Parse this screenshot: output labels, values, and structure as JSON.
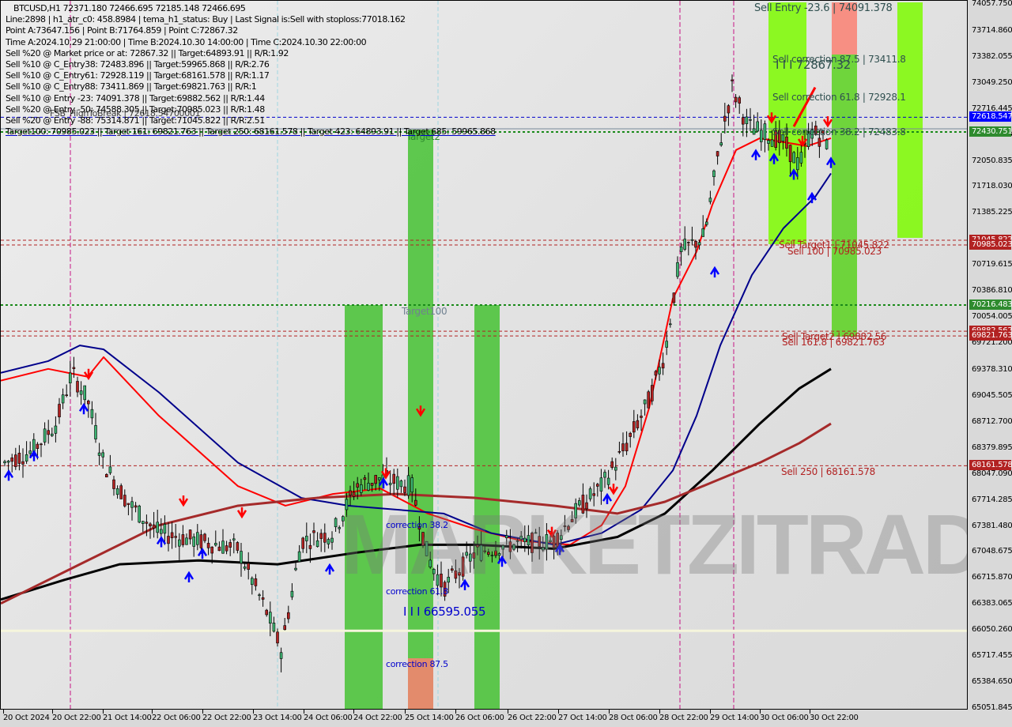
{
  "chart_data": {
    "type": "candlestick",
    "symbol": "BTCUSD",
    "timeframe": "H1",
    "ohlc_header": {
      "open": "72371.180",
      "high": "72466.695",
      "low": "72185.148",
      "close": "72466.695"
    },
    "ylim": [
      65051.845,
      74057.75
    ],
    "y_ticks": [
      "74057.750",
      "73714.860",
      "73382.055",
      "73049.250",
      "72716.445",
      "72383.640",
      "72050.835",
      "71718.030",
      "71385.225",
      "70719.615",
      "70386.810",
      "70054.005",
      "69721.200",
      "69378.310",
      "69045.505",
      "68712.700",
      "68379.895",
      "68047.090",
      "67714.285",
      "67381.480",
      "67048.675",
      "66715.870",
      "66383.065",
      "66050.260",
      "65717.455",
      "65384.650",
      "65051.845"
    ],
    "y_tick_values": [
      74057.75,
      73714.86,
      73382.055,
      73049.25,
      72716.445,
      72383.64,
      72050.835,
      71718.03,
      71385.225,
      70719.615,
      70386.81,
      70054.005,
      69721.2,
      69378.31,
      69045.505,
      68712.7,
      68379.895,
      68047.09,
      67714.285,
      67381.48,
      67048.675,
      66715.87,
      66383.065,
      66050.26,
      65717.455,
      65384.65,
      65051.845
    ],
    "x_ticks": [
      "20 Oct 2024",
      "20 Oct 22:00",
      "21 Oct 14:00",
      "22 Oct 06:00",
      "22 Oct 22:00",
      "23 Oct 14:00",
      "24 Oct 06:00",
      "24 Oct 22:00",
      "25 Oct 14:00",
      "26 Oct 06:00",
      "26 Oct 22:00",
      "27 Oct 14:00",
      "28 Oct 06:00",
      "28 Oct 22:00",
      "29 Oct 14:00",
      "30 Oct 06:00",
      "30 Oct 22:00"
    ],
    "price_tags": [
      {
        "label": "72618.547",
        "value": 72618.547,
        "color": "#0000ff"
      },
      {
        "label": "72430.751",
        "value": 72430.751,
        "color": "#2e8b2e"
      },
      {
        "label": "71045.822",
        "value": 71045.822,
        "color": "#b22222"
      },
      {
        "label": "70985.023",
        "value": 70985.023,
        "color": "#b22222"
      },
      {
        "label": "70216.483",
        "value": 70216.483,
        "color": "#2e8b2e"
      },
      {
        "label": "69882.562",
        "value": 69882.562,
        "color": "#b22222"
      },
      {
        "label": "69821.763",
        "value": 69821.763,
        "color": "#b22222"
      },
      {
        "label": "68161.578",
        "value": 68161.578,
        "color": "#b22222"
      }
    ],
    "horizontal_levels": [
      {
        "value": 72618.547,
        "style": "dashed",
        "color": "#0000cc"
      },
      {
        "value": 72430.751,
        "style": "dotted",
        "color": "#1a8a1a"
      },
      {
        "value": 71045.822,
        "style": "dashed",
        "color": "#b22222"
      },
      {
        "value": 70985.023,
        "style": "dashed",
        "color": "#b22222"
      },
      {
        "value": 70216.483,
        "style": "dotted",
        "color": "#1a8a1a"
      },
      {
        "value": 69882.562,
        "style": "dashed",
        "color": "#b22222"
      },
      {
        "value": 69821.763,
        "style": "dashed",
        "color": "#b22222"
      },
      {
        "value": 68161.578,
        "style": "dashed",
        "color": "#b22222"
      },
      {
        "value": 66050.26,
        "style": "solid",
        "color": "#f5f5dc"
      }
    ],
    "annotations": [
      {
        "id": "sell-entry",
        "text": "Sell Entry -23.6 | 74091.378",
        "color": "#2f4f4f"
      },
      {
        "id": "sell-corr-875",
        "text": "Sell correction 87.5 | 73411.8",
        "color": "#2f4f4f"
      },
      {
        "id": "point-c",
        "text": "I I I 72867.32",
        "color": "#2f4f4f"
      },
      {
        "id": "sell-corr-618",
        "text": "Sell correction 61.8 | 72928.1",
        "color": "#2f4f4f"
      },
      {
        "id": "sell-corr-382",
        "text": "Sell correction 38.2 | 72483.8",
        "color": "#2f4f4f"
      },
      {
        "id": "sell-target1",
        "text": "Sell Target1 | 71045.822",
        "color": "#b22222"
      },
      {
        "id": "sell-100",
        "text": "Sell 100 | 70985.023",
        "color": "#b22222"
      },
      {
        "id": "sell-target2",
        "text": "Sell Target2 | 69882.56",
        "color": "#b22222"
      },
      {
        "id": "sell-1618",
        "text": "Sell 161.8 | 69821.763",
        "color": "#b22222"
      },
      {
        "id": "sell-250",
        "text": "Sell 250 | 68161.578",
        "color": "#b22222"
      },
      {
        "id": "target2",
        "text": "Target2",
        "color": "#2e8b2e"
      },
      {
        "id": "target100",
        "text": "Target100",
        "color": "#708090"
      },
      {
        "id": "correction-382",
        "text": "correction 38.2",
        "color": "#0000cc"
      },
      {
        "id": "correction-618",
        "text": "correction 61.8",
        "color": "#0000cc"
      },
      {
        "id": "correction-875",
        "text": "correction 87.5",
        "color": "#0000cc"
      },
      {
        "id": "point-low",
        "text": "I I I 66595.055",
        "color": "#0000cc"
      }
    ],
    "series": [
      {
        "name": "EMA fast",
        "color": "#ff0000"
      },
      {
        "name": "MA mid",
        "color": "#00008b"
      },
      {
        "name": "MA slow",
        "color": "#000000"
      },
      {
        "name": "MA long",
        "color": "#a52a2a"
      }
    ]
  },
  "info_panel": {
    "title": "BTCUSD,H1  72371.180 72466.695 72185.148 72466.695",
    "lines": [
      "Line:2898 | h1_atr_c0: 458.8984 | tema_h1_status: Buy | Last Signal is:Sell with stoploss:77018.162",
      "Point A:73647.156 | Point B:71764.859 | Point C:72867.32",
      "Time A:2024.10.29 21:00:00 | Time B:2024.10.30 14:00:00 | Time C:2024.10.30 22:00:00",
      "Sell %20 @ Market price or at: 72867.32 || Target:64893.91 || R/R:1.92",
      "Sell %10 @ C_Entry38: 72483.896 || Target:59965.868 || R/R:2.76",
      "Sell %10 @ C_Entry61: 72928.119 || Target:68161.578 || R/R:1.17",
      "Sell %10 @ C_Entry88: 73411.869 || Target:69821.763 || R/R:1",
      "Sell %10 @ Entry -23: 74091.378 || Target:69882.562 || R/R:1.44",
      "Sell %20 @ Entry -50: 74588.305 || Target:70985.023 || R/R:1.48",
      "Sell %20 @ Entry -88: 75314.871 || Target:71045.822 || R/R:2.51",
      "Target100: 70985.023 || Target 161: 69821.763 || Target 250: 68161.578 || Target 423: 64893.91 || Target 685: 59965.868"
    ],
    "overlay": "FSB_HighToBreak | 72618.54700001"
  },
  "watermark": "MARKETZITRADE"
}
